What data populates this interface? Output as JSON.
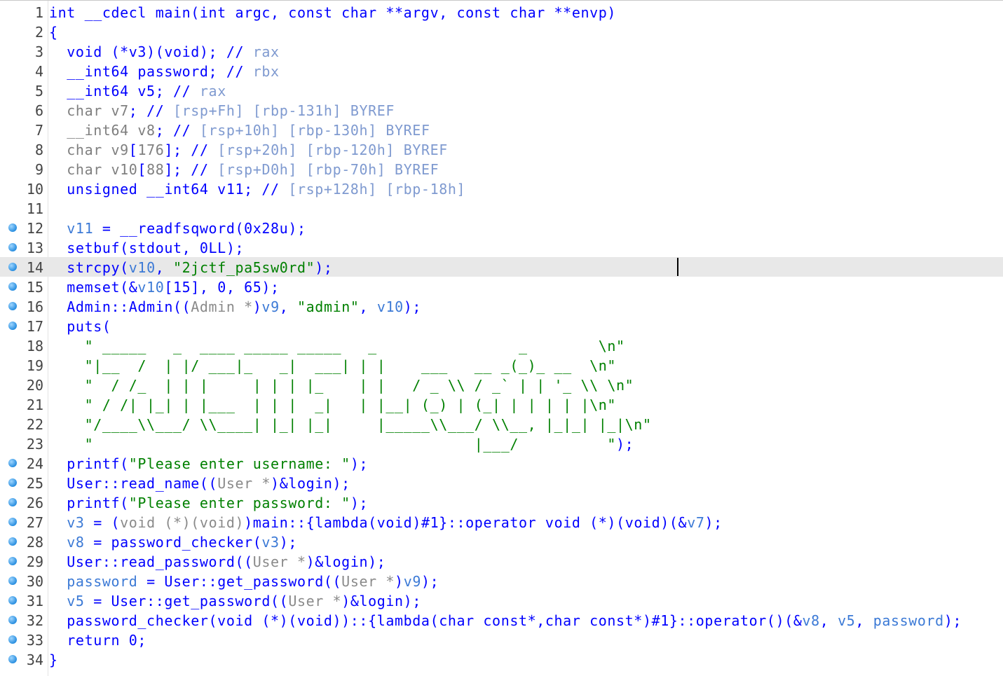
{
  "editor": {
    "lines": [
      {
        "n": "1",
        "bp": false,
        "cur": false,
        "tokens": [
          {
            "c": "k",
            "t": "int __cdecl main(int argc, const char **argv, const char **envp)"
          }
        ]
      },
      {
        "n": "2",
        "bp": false,
        "cur": false,
        "tokens": [
          {
            "c": "k",
            "t": "{"
          }
        ]
      },
      {
        "n": "3",
        "bp": false,
        "cur": false,
        "tokens": [
          {
            "c": "k",
            "t": "  void (*v3)(void); // "
          },
          {
            "c": "cv",
            "t": "rax"
          }
        ]
      },
      {
        "n": "4",
        "bp": false,
        "cur": false,
        "tokens": [
          {
            "c": "k",
            "t": "  __int64 password; // "
          },
          {
            "c": "cv",
            "t": "rbx"
          }
        ]
      },
      {
        "n": "5",
        "bp": false,
        "cur": false,
        "tokens": [
          {
            "c": "k",
            "t": "  __int64 v5; // "
          },
          {
            "c": "cv",
            "t": "rax"
          }
        ]
      },
      {
        "n": "6",
        "bp": false,
        "cur": false,
        "tokens": [
          {
            "c": "c",
            "t": "  char v7"
          },
          {
            "c": "k",
            "t": "; // "
          },
          {
            "c": "cv",
            "t": "[rsp+Fh] [rbp-131h] BYREF"
          }
        ]
      },
      {
        "n": "7",
        "bp": false,
        "cur": false,
        "tokens": [
          {
            "c": "c",
            "t": "  __int64 v8"
          },
          {
            "c": "k",
            "t": "; // "
          },
          {
            "c": "cv",
            "t": "[rsp+10h] [rbp-130h] BYREF"
          }
        ]
      },
      {
        "n": "8",
        "bp": false,
        "cur": false,
        "tokens": [
          {
            "c": "c",
            "t": "  char v9"
          },
          {
            "c": "k",
            "t": "["
          },
          {
            "c": "c",
            "t": "176"
          },
          {
            "c": "k",
            "t": "]; // "
          },
          {
            "c": "cv",
            "t": "[rsp+20h] [rbp-120h] BYREF"
          }
        ]
      },
      {
        "n": "9",
        "bp": false,
        "cur": false,
        "tokens": [
          {
            "c": "c",
            "t": "  char v10"
          },
          {
            "c": "k",
            "t": "["
          },
          {
            "c": "c",
            "t": "88"
          },
          {
            "c": "k",
            "t": "]; // "
          },
          {
            "c": "cv",
            "t": "[rsp+D0h] [rbp-70h] BYREF"
          }
        ]
      },
      {
        "n": "10",
        "bp": false,
        "cur": false,
        "tokens": [
          {
            "c": "k",
            "t": "  unsigned __int64 v11; // "
          },
          {
            "c": "cv",
            "t": "[rsp+128h] [rbp-18h]"
          }
        ]
      },
      {
        "n": "11",
        "bp": false,
        "cur": false,
        "tokens": [
          {
            "c": "k",
            "t": ""
          }
        ]
      },
      {
        "n": "12",
        "bp": true,
        "cur": false,
        "tokens": [
          {
            "c": "v",
            "t": "  v11"
          },
          {
            "c": "k",
            "t": " = __readfsqword(0x28u);"
          }
        ]
      },
      {
        "n": "13",
        "bp": true,
        "cur": false,
        "tokens": [
          {
            "c": "k",
            "t": "  setbuf(stdout, 0LL);"
          }
        ]
      },
      {
        "n": "14",
        "bp": true,
        "cur": true,
        "tokens": [
          {
            "c": "k",
            "t": "  strcpy("
          },
          {
            "c": "v",
            "t": "v10"
          },
          {
            "c": "k",
            "t": ", "
          },
          {
            "c": "s",
            "t": "\"2jctf_pa5sw0rd\""
          },
          {
            "c": "k",
            "t": ");"
          }
        ]
      },
      {
        "n": "15",
        "bp": true,
        "cur": false,
        "tokens": [
          {
            "c": "k",
            "t": "  memset(&"
          },
          {
            "c": "v",
            "t": "v10"
          },
          {
            "c": "k",
            "t": "[15], 0, 65);"
          }
        ]
      },
      {
        "n": "16",
        "bp": true,
        "cur": false,
        "tokens": [
          {
            "c": "k",
            "t": "  Admin::Admin(("
          },
          {
            "c": "g",
            "t": "Admin *"
          },
          {
            "c": "k",
            "t": ")"
          },
          {
            "c": "v",
            "t": "v9"
          },
          {
            "c": "k",
            "t": ", "
          },
          {
            "c": "s",
            "t": "\"admin\""
          },
          {
            "c": "k",
            "t": ", "
          },
          {
            "c": "v",
            "t": "v10"
          },
          {
            "c": "k",
            "t": ");"
          }
        ]
      },
      {
        "n": "17",
        "bp": true,
        "cur": false,
        "tokens": [
          {
            "c": "k",
            "t": "  puts("
          }
        ]
      },
      {
        "n": "18",
        "bp": false,
        "cur": false,
        "tokens": [
          {
            "c": "s",
            "t": "    \" _____   _  ____ _____ _____   _                _        \\n\""
          }
        ]
      },
      {
        "n": "19",
        "bp": false,
        "cur": false,
        "tokens": [
          {
            "c": "s",
            "t": "    \"|__  /  | |/ ___|_   _|  ___| | |    ___   __ _(_)_ __  \\n\""
          }
        ]
      },
      {
        "n": "20",
        "bp": false,
        "cur": false,
        "tokens": [
          {
            "c": "s",
            "t": "    \"  / /_  | | |     | | | |_    | |   / _ \\\\ / _` | | '_ \\\\ \\n\""
          }
        ]
      },
      {
        "n": "21",
        "bp": false,
        "cur": false,
        "tokens": [
          {
            "c": "s",
            "t": "    \" / /| |_| | |___  | | |  _|   | |__| (_) | (_| | | | | |\\n\""
          }
        ]
      },
      {
        "n": "22",
        "bp": false,
        "cur": false,
        "tokens": [
          {
            "c": "s",
            "t": "    \"/____\\\\___/ \\\\____| |_| |_|     |_____\\\\___/ \\\\__, |_|_| |_|\\n\""
          }
        ]
      },
      {
        "n": "23",
        "bp": false,
        "cur": false,
        "tokens": [
          {
            "c": "s",
            "t": "    \"                                           |___/          \""
          },
          {
            "c": "k",
            "t": ");"
          }
        ]
      },
      {
        "n": "24",
        "bp": true,
        "cur": false,
        "tokens": [
          {
            "c": "k",
            "t": "  printf("
          },
          {
            "c": "s",
            "t": "\"Please enter username: \""
          },
          {
            "c": "k",
            "t": ");"
          }
        ]
      },
      {
        "n": "25",
        "bp": true,
        "cur": false,
        "tokens": [
          {
            "c": "k",
            "t": "  User::read_name(("
          },
          {
            "c": "g",
            "t": "User *"
          },
          {
            "c": "k",
            "t": ")&login);"
          }
        ]
      },
      {
        "n": "26",
        "bp": true,
        "cur": false,
        "tokens": [
          {
            "c": "k",
            "t": "  printf("
          },
          {
            "c": "s",
            "t": "\"Please enter password: \""
          },
          {
            "c": "k",
            "t": ");"
          }
        ]
      },
      {
        "n": "27",
        "bp": true,
        "cur": false,
        "tokens": [
          {
            "c": "v",
            "t": "  v3"
          },
          {
            "c": "k",
            "t": " = ("
          },
          {
            "c": "g",
            "t": "void (*)(void)"
          },
          {
            "c": "k",
            "t": ")main::{lambda(void)#1}::operator void (*)(void)(&"
          },
          {
            "c": "v",
            "t": "v7"
          },
          {
            "c": "k",
            "t": ");"
          }
        ]
      },
      {
        "n": "28",
        "bp": true,
        "cur": false,
        "tokens": [
          {
            "c": "v",
            "t": "  v8"
          },
          {
            "c": "k",
            "t": " = password_checker("
          },
          {
            "c": "v",
            "t": "v3"
          },
          {
            "c": "k",
            "t": ");"
          }
        ]
      },
      {
        "n": "29",
        "bp": true,
        "cur": false,
        "tokens": [
          {
            "c": "k",
            "t": "  User::read_password(("
          },
          {
            "c": "g",
            "t": "User *"
          },
          {
            "c": "k",
            "t": ")&login);"
          }
        ]
      },
      {
        "n": "30",
        "bp": true,
        "cur": false,
        "tokens": [
          {
            "c": "v",
            "t": "  password"
          },
          {
            "c": "k",
            "t": " = User::get_password(("
          },
          {
            "c": "g",
            "t": "User *"
          },
          {
            "c": "k",
            "t": ")"
          },
          {
            "c": "v",
            "t": "v9"
          },
          {
            "c": "k",
            "t": ");"
          }
        ]
      },
      {
        "n": "31",
        "bp": true,
        "cur": false,
        "tokens": [
          {
            "c": "v",
            "t": "  v5"
          },
          {
            "c": "k",
            "t": " = User::get_password(("
          },
          {
            "c": "g",
            "t": "User *"
          },
          {
            "c": "k",
            "t": ")&login);"
          }
        ]
      },
      {
        "n": "32",
        "bp": true,
        "cur": false,
        "tokens": [
          {
            "c": "k",
            "t": "  password_checker(void (*)(void))::{lambda(char const*,char const*)#1}::operator()(&"
          },
          {
            "c": "v",
            "t": "v8"
          },
          {
            "c": "k",
            "t": ", "
          },
          {
            "c": "v",
            "t": "v5"
          },
          {
            "c": "k",
            "t": ", "
          },
          {
            "c": "v",
            "t": "password"
          },
          {
            "c": "k",
            "t": ");"
          }
        ]
      },
      {
        "n": "33",
        "bp": true,
        "cur": false,
        "tokens": [
          {
            "c": "k",
            "t": "  return 0;"
          }
        ]
      },
      {
        "n": "34",
        "bp": true,
        "cur": false,
        "tokens": [
          {
            "c": "k",
            "t": "}"
          }
        ]
      }
    ],
    "colors": {
      "keyword": "#0000ff",
      "variable": "#3c7ad6",
      "comment": "#7f9ad0",
      "string": "#008000",
      "gray": "#8a8a8a",
      "current_line": "#e8e8e8",
      "breakpoint": "#2a8fe0"
    },
    "icons": {
      "breakpoint": "breakpoint-dot-icon"
    }
  }
}
